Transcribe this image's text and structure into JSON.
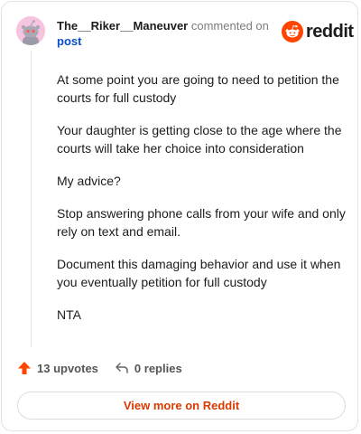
{
  "comment": {
    "author": "The__Riker__Maneuver",
    "commented_on_label": "commented on",
    "post_link_label": "post",
    "paragraphs": [
      "At some point you are going to need to petition the courts for full custody",
      "Your daughter is getting close to the age where the courts will take her choice into consideration",
      "My advice?",
      "Stop answering phone calls from your wife and only rely on text and email.",
      "Document this damaging behavior and use it when you eventually petition for full custody",
      "NTA"
    ]
  },
  "brand": {
    "name": "reddit",
    "accent": "#ff4500",
    "icon": "reddit-snoo-icon"
  },
  "actions": {
    "upvotes_label": "13 upvotes",
    "replies_label": "0 replies",
    "upvote_icon": "upvote-arrow-icon",
    "reply_icon": "reply-arrow-icon"
  },
  "footer": {
    "view_more_label": "View more on Reddit"
  },
  "colors": {
    "link": "#0a4fcc",
    "upvote": "#ff4500",
    "view_more": "#d93a00",
    "avatar_bg": "#f7c4df"
  }
}
